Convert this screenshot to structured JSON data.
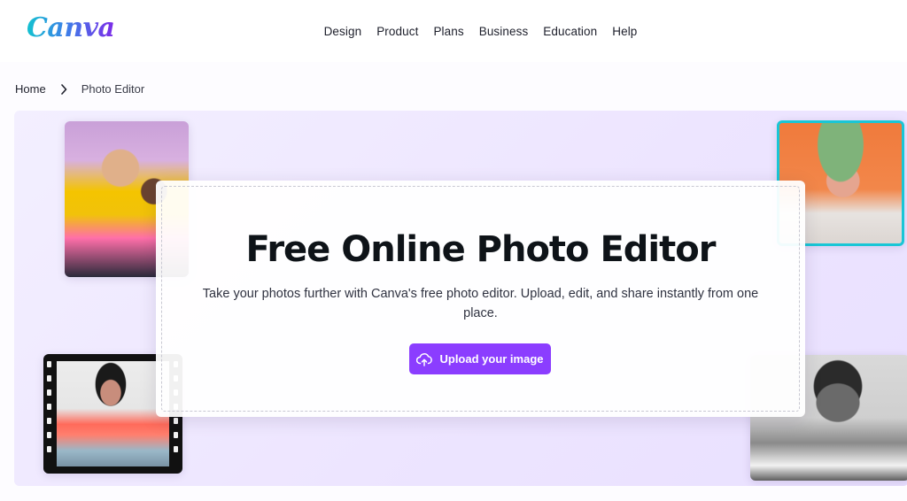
{
  "header": {
    "logo_text": "Canva",
    "nav": [
      {
        "label": "Design"
      },
      {
        "label": "Product"
      },
      {
        "label": "Plans"
      },
      {
        "label": "Business"
      },
      {
        "label": "Education"
      },
      {
        "label": "Help"
      }
    ]
  },
  "breadcrumb": {
    "home": "Home",
    "current": "Photo Editor",
    "separator_icon": "chevron-right-icon"
  },
  "hero": {
    "title": "Free Online Photo Editor",
    "subtitle": "Take your photos further with Canva's free photo editor. Upload, edit, and share instantly from one place.",
    "upload_button": {
      "label": "Upload your image",
      "icon": "cloud-upload-icon"
    }
  },
  "colors": {
    "accent": "#8b3dff",
    "hero_bg": "#efe8ff",
    "photo_border": "#19c6d6"
  }
}
